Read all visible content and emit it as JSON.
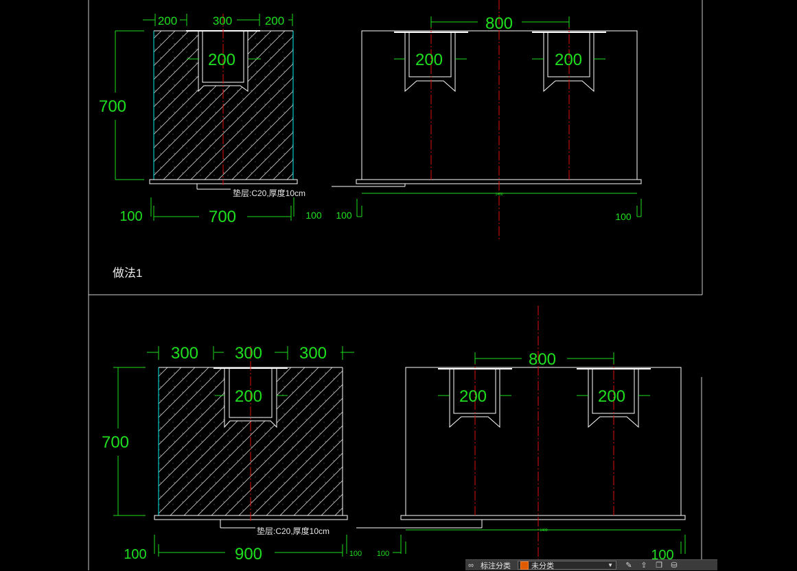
{
  "drawing": {
    "upper": {
      "top_dims": [
        "200",
        "300",
        "200"
      ],
      "height_dim": "700",
      "bottom_left": "100",
      "bottom_width": "700",
      "bottom_right": "100",
      "cut_dim_left": "200",
      "elevation_top": "800",
      "elevation_cuts": [
        "200",
        "200"
      ],
      "elevation_base_left": "100",
      "elevation_base_right": "100",
      "elevation_span": "1400",
      "cushion_note": "垫层:C20,厚度10cm",
      "method_label": "做法1"
    },
    "lower": {
      "top_dims": [
        "300",
        "300",
        "300"
      ],
      "height_dim": "700",
      "bottom_left": "100",
      "bottom_width": "900",
      "bottom_right": "100",
      "cut_dim_left": "200",
      "elevation_top": "800",
      "elevation_cuts": [
        "200",
        "200"
      ],
      "elevation_base_left": "100",
      "elevation_base_right": "100",
      "elevation_span": "1400",
      "cushion_note": "垫层:C20,厚度10cm"
    }
  },
  "toolbar": {
    "label": "标注分类",
    "selected": "未分类",
    "swatch_color": "#e05a00"
  },
  "colors": {
    "background": "#000000",
    "dimension": "#1fe01f",
    "outline": "#ffffff",
    "centerline": "#e01010",
    "hatch_edge": "#00c8c8"
  }
}
